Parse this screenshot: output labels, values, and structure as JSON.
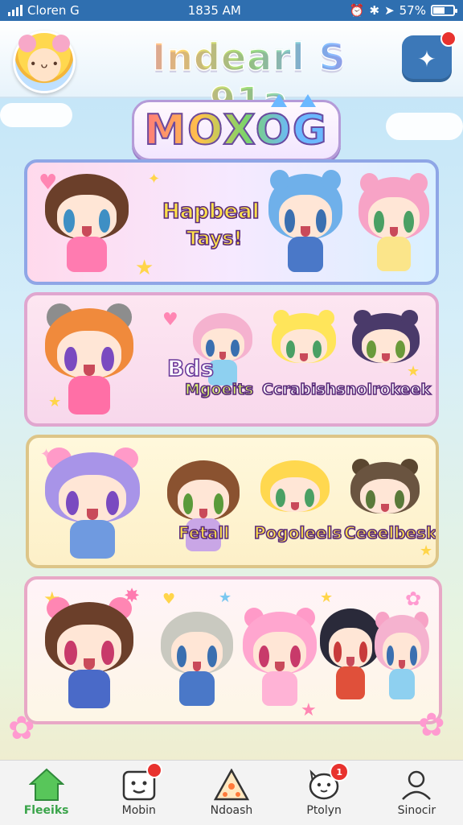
{
  "status_bar": {
    "carrier": "Cloren G",
    "time": "1835 AM",
    "battery": "57%"
  },
  "header": {
    "title": "Indearl S 91a",
    "notification_count": ""
  },
  "logo": {
    "text": "MOXOG"
  },
  "cards": [
    {
      "labels": [
        "Hapbeal",
        "Tays!"
      ]
    },
    {
      "labels": [
        "Bds",
        "Mgoeits",
        "Ccrabishs",
        "nolrokeek"
      ]
    },
    {
      "labels": [
        "Fetall",
        "Pogoleels",
        "Ceeelbesk"
      ]
    },
    {
      "labels": []
    }
  ],
  "tabs": [
    {
      "label": "Fleeiks",
      "icon": "home-icon",
      "active": true
    },
    {
      "label": "Mobin",
      "icon": "face-icon",
      "badge": ""
    },
    {
      "label": "Ndoash",
      "icon": "pizza-icon"
    },
    {
      "label": "Ptolyn",
      "icon": "cat-icon",
      "badge": "1"
    },
    {
      "label": "Sinocir",
      "icon": "profile-icon"
    }
  ],
  "colors": {
    "status_bar": "#2f6fb0",
    "accent_active_tab": "#3aa44a",
    "badge": "#e8322e"
  }
}
